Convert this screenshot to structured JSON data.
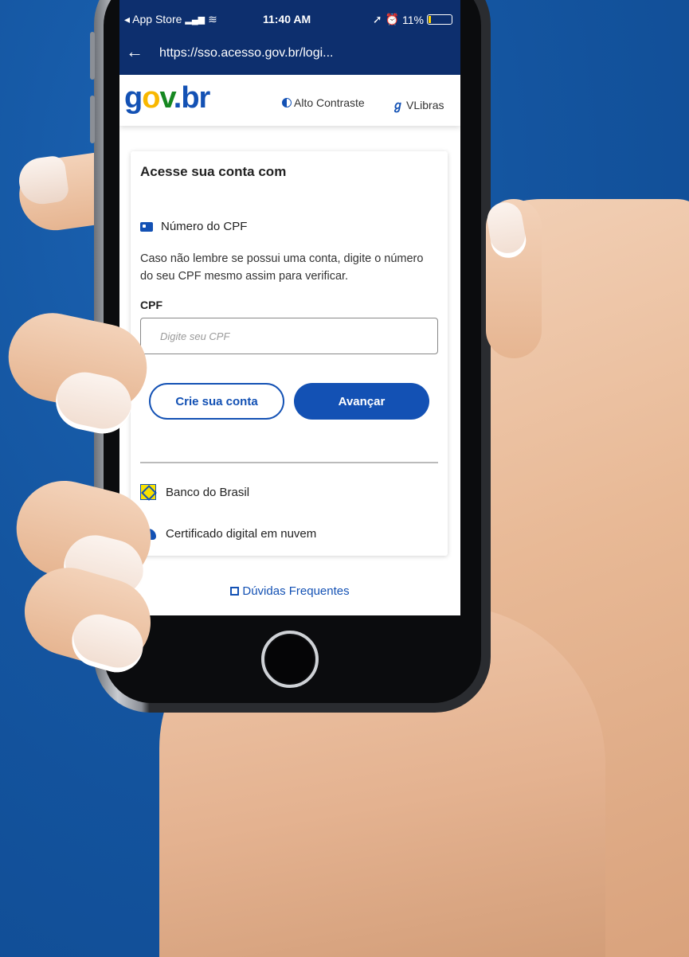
{
  "status_bar": {
    "back_app": "◂ App Store",
    "signal": "▂▄▆",
    "wifi": "≋",
    "time": "11:40 AM",
    "battery_pct": "11%",
    "battery_level": 0.11,
    "location_icon": "location-arrow-icon",
    "alarm_icon": "alarm-icon"
  },
  "browser": {
    "url": "https://sso.acesso.gov.br/logi..."
  },
  "header": {
    "logo": {
      "g": "g",
      "o": "o",
      "v": "v",
      "dot": ".",
      "br": "br"
    },
    "contrast_label": "Alto Contraste",
    "libras_label": "VLibras"
  },
  "card": {
    "title": "Acesse sua conta com",
    "cpf_option_label": "Número do CPF",
    "help_text": "Caso não lembre se possui uma conta, digite o número do seu CPF mesmo assim para verificar.",
    "cpf_field_label": "CPF",
    "cpf_placeholder": "Digite seu CPF",
    "create_account_label": "Crie sua conta",
    "next_label": "Avançar",
    "other_options": [
      {
        "label": "Banco do Brasil",
        "icon": "banco-do-brasil-icon"
      },
      {
        "label": "Certificado digital em nuvem",
        "icon": "cloud-certificate-icon"
      }
    ]
  },
  "footer": {
    "faq_label": "Dúvidas Frequentes"
  },
  "colors": {
    "background": "#1455a0",
    "brand_blue": "#1351b4",
    "status_bar": "#0d2f6e",
    "logo_yellow": "#f8b700",
    "logo_green": "#168821"
  }
}
